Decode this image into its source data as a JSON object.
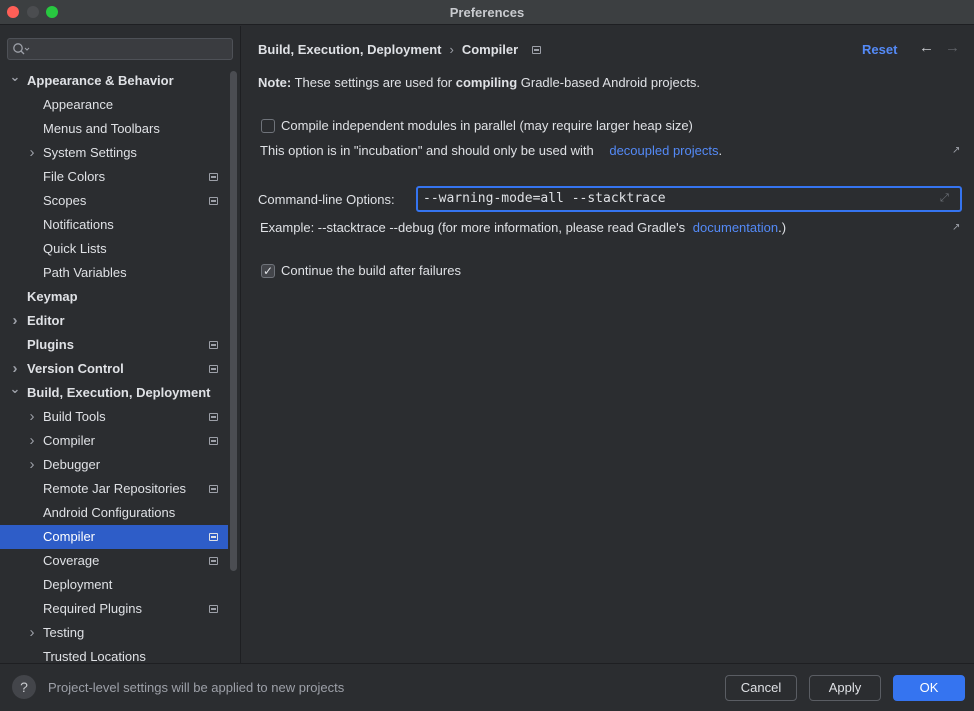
{
  "window": {
    "title": "Preferences"
  },
  "search": {
    "placeholder": ""
  },
  "sidebar": {
    "items": [
      {
        "label": "Appearance & Behavior",
        "level": 0,
        "bold": true,
        "expandable": true,
        "expanded": true,
        "project": false,
        "selected": false
      },
      {
        "label": "Appearance",
        "level": 1,
        "bold": false,
        "expandable": false,
        "project": false,
        "selected": false
      },
      {
        "label": "Menus and Toolbars",
        "level": 1,
        "bold": false,
        "expandable": false,
        "project": false,
        "selected": false
      },
      {
        "label": "System Settings",
        "level": 1,
        "bold": false,
        "expandable": true,
        "expanded": false,
        "project": false,
        "selected": false
      },
      {
        "label": "File Colors",
        "level": 1,
        "bold": false,
        "expandable": false,
        "project": true,
        "selected": false
      },
      {
        "label": "Scopes",
        "level": 1,
        "bold": false,
        "expandable": false,
        "project": true,
        "selected": false
      },
      {
        "label": "Notifications",
        "level": 1,
        "bold": false,
        "expandable": false,
        "project": false,
        "selected": false
      },
      {
        "label": "Quick Lists",
        "level": 1,
        "bold": false,
        "expandable": false,
        "project": false,
        "selected": false
      },
      {
        "label": "Path Variables",
        "level": 1,
        "bold": false,
        "expandable": false,
        "project": false,
        "selected": false
      },
      {
        "label": "Keymap",
        "level": 0,
        "bold": true,
        "expandable": false,
        "project": false,
        "selected": false
      },
      {
        "label": "Editor",
        "level": 0,
        "bold": true,
        "expandable": true,
        "expanded": false,
        "project": false,
        "selected": false
      },
      {
        "label": "Plugins",
        "level": 0,
        "bold": true,
        "expandable": false,
        "project": true,
        "selected": false
      },
      {
        "label": "Version Control",
        "level": 0,
        "bold": true,
        "expandable": true,
        "expanded": false,
        "project": true,
        "selected": false
      },
      {
        "label": "Build, Execution, Deployment",
        "level": 0,
        "bold": true,
        "expandable": true,
        "expanded": true,
        "project": false,
        "selected": false
      },
      {
        "label": "Build Tools",
        "level": 1,
        "bold": false,
        "expandable": true,
        "expanded": false,
        "project": true,
        "selected": false
      },
      {
        "label": "Compiler",
        "level": 1,
        "bold": false,
        "expandable": true,
        "expanded": false,
        "project": true,
        "selected": false
      },
      {
        "label": "Debugger",
        "level": 1,
        "bold": false,
        "expandable": true,
        "expanded": false,
        "project": false,
        "selected": false
      },
      {
        "label": "Remote Jar Repositories",
        "level": 1,
        "bold": false,
        "expandable": false,
        "project": true,
        "selected": false
      },
      {
        "label": "Android Configurations",
        "level": 1,
        "bold": false,
        "expandable": false,
        "project": false,
        "selected": false
      },
      {
        "label": "Compiler",
        "level": 1,
        "bold": false,
        "expandable": false,
        "project": true,
        "selected": true
      },
      {
        "label": "Coverage",
        "level": 1,
        "bold": false,
        "expandable": false,
        "project": true,
        "selected": false
      },
      {
        "label": "Deployment",
        "level": 1,
        "bold": false,
        "expandable": false,
        "project": false,
        "selected": false
      },
      {
        "label": "Required Plugins",
        "level": 1,
        "bold": false,
        "expandable": false,
        "project": true,
        "selected": false
      },
      {
        "label": "Testing",
        "level": 1,
        "bold": false,
        "expandable": true,
        "expanded": false,
        "project": false,
        "selected": false
      },
      {
        "label": "Trusted Locations",
        "level": 1,
        "bold": false,
        "expandable": false,
        "project": false,
        "selected": false
      }
    ]
  },
  "header": {
    "breadcrumb_parent": "Build, Execution, Deployment",
    "breadcrumb_sep": "›",
    "breadcrumb_current": "Compiler",
    "reset_label": "Reset",
    "back_icon": "←",
    "forward_icon": "→"
  },
  "note": {
    "prefix": "Note:",
    "text_before": " These settings are used for ",
    "emphasis": "compiling",
    "text_after": " Gradle-based Android projects."
  },
  "parallel": {
    "label": "Compile independent modules in parallel (may require larger heap size)",
    "checked": false,
    "hint": "This option is in \"incubation\" and should only be used with",
    "link": "decoupled projects",
    "hint_end": "."
  },
  "command_line": {
    "label": "Command-line Options:",
    "value": "--warning-mode=all --stacktrace",
    "example_text": "Example: --stacktrace --debug (for more information, please read Gradle's",
    "example_link": "documentation",
    "example_end": ".)"
  },
  "continue_build": {
    "label": "Continue the build after failures",
    "checked": true
  },
  "footer": {
    "help_label": "?",
    "text": "Project-level settings will be applied to new projects",
    "cancel_label": "Cancel",
    "apply_label": "Apply",
    "ok_label": "OK"
  },
  "colors": {
    "accent": "#3574f0",
    "link": "#548af7",
    "selection": "#2e5dc8",
    "background": "#2b2d30"
  }
}
